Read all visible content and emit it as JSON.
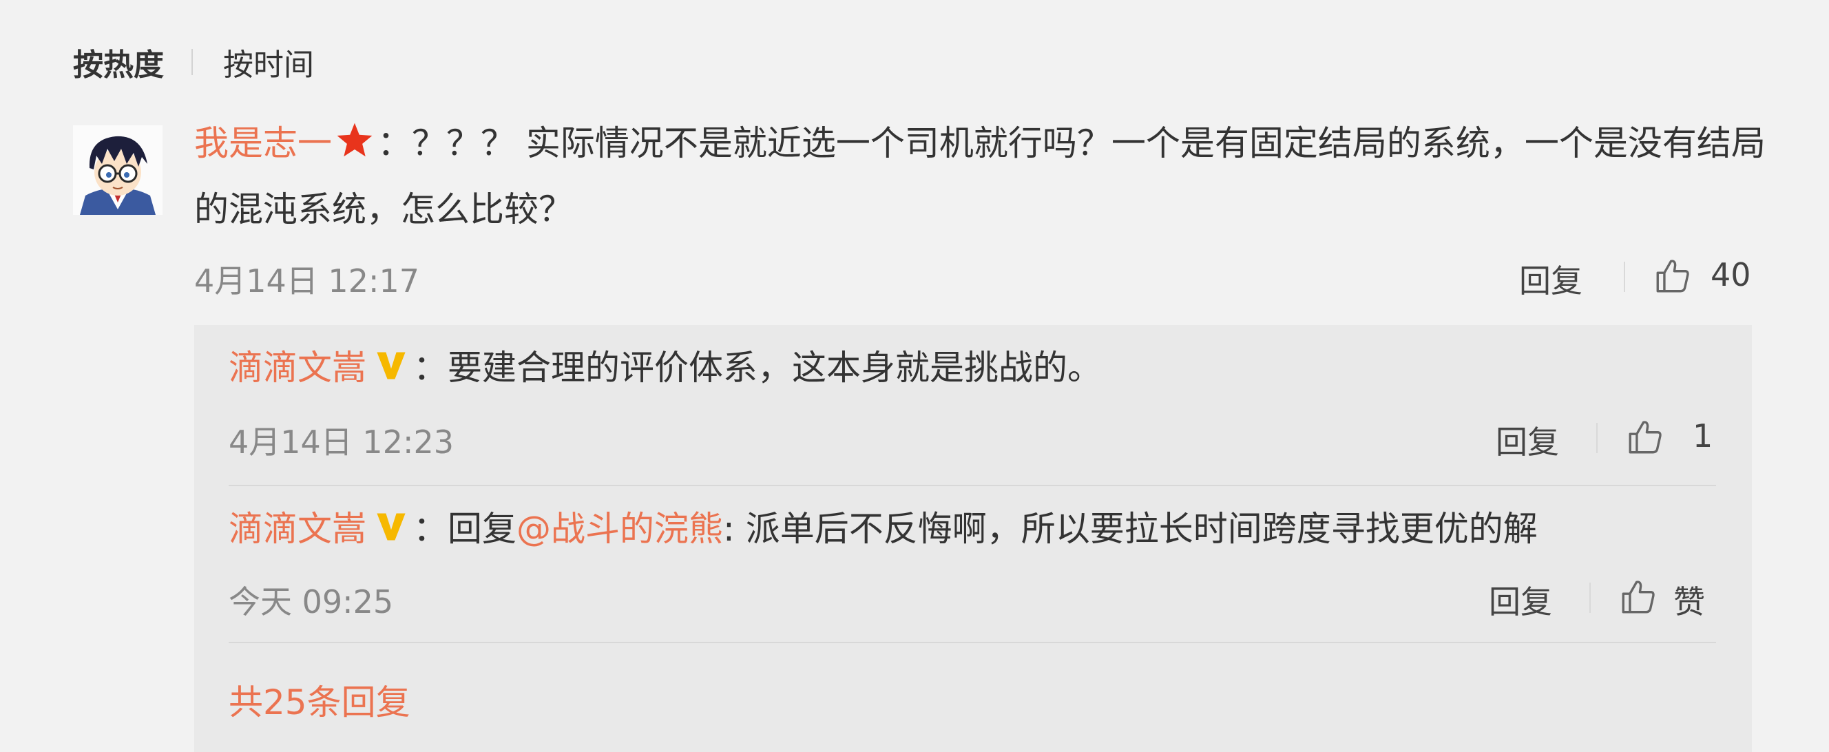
{
  "sort_tabs": [
    {
      "label": "按热度",
      "active": true
    },
    {
      "label": "按时间",
      "active": false
    }
  ],
  "comment": {
    "username": "我是志一",
    "badge_icon": "red-star-icon",
    "separator": "：",
    "text": "？？？ 实际情况不是就近选一个司机就行吗？一个是有固定结局的系统，一个是没有结局的混沌系统，怎么比较？",
    "timestamp": "4月14日 12:17",
    "reply_label": "回复",
    "like_count": "40"
  },
  "replies": [
    {
      "username": "滴滴文嵩",
      "badge_icon": "verified-v-icon",
      "separator": "：",
      "prefix": "",
      "mention": "",
      "text": "要建合理的评价体系，这本身就是挑战的。",
      "timestamp": "4月14日 12:23",
      "reply_label": "回复",
      "like_label": "1"
    },
    {
      "username": "滴滴文嵩",
      "badge_icon": "verified-v-icon",
      "separator": "：",
      "prefix": "回复",
      "mention": "@战斗的浣熊",
      "text": ": 派单后不反悔啊，所以要拉长时间跨度寻找更优的解",
      "timestamp": "今天 09:25",
      "reply_label": "回复",
      "like_label": "赞"
    }
  ],
  "more_replies": "共25条回复",
  "colors": {
    "link": "#eb7350",
    "badge_star": "#e8341c",
    "badge_v": "#f6b800",
    "background": "#f2f2f2",
    "reply_background": "#e9e9e9"
  }
}
